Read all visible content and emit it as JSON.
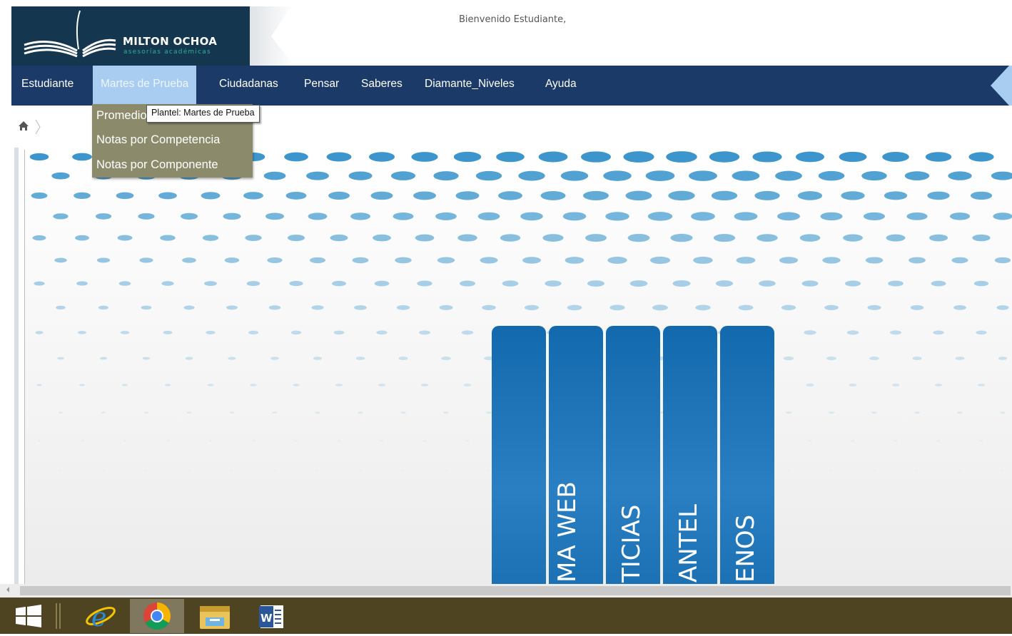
{
  "header": {
    "logo_title": "MILTON OCHOA",
    "logo_subtitle": "asesorías académicas",
    "welcome": "Bienvenido Estudiante,"
  },
  "nav": {
    "items": [
      "Estudiante",
      "Martes de Prueba",
      "Ciudadanas",
      "Pensar",
      "Saberes",
      "Diamante_Niveles",
      "Ayuda"
    ],
    "active": "Martes de Prueba"
  },
  "dropdown": {
    "items": [
      "Promedio",
      "Notas por Competencia",
      "Notas por Componente"
    ]
  },
  "tooltip": "Plantel: Martes de Prueba",
  "tabs": [
    "",
    "MA WEB",
    "TICIAS",
    "ANTEL",
    "ENOS"
  ],
  "taskbar": {
    "apps": [
      "windows-start",
      "internet-explorer",
      "chrome",
      "file-explorer",
      "microsoft-word"
    ],
    "active": "chrome"
  },
  "colors": {
    "logo_bg": "#14364f",
    "navbar": "#1c3a68",
    "active_nav": "#a9cdf1",
    "dropdown_bg": "#8b8b6b",
    "tab_blue": "#1a6fb3",
    "taskbar": "#4e4421"
  }
}
